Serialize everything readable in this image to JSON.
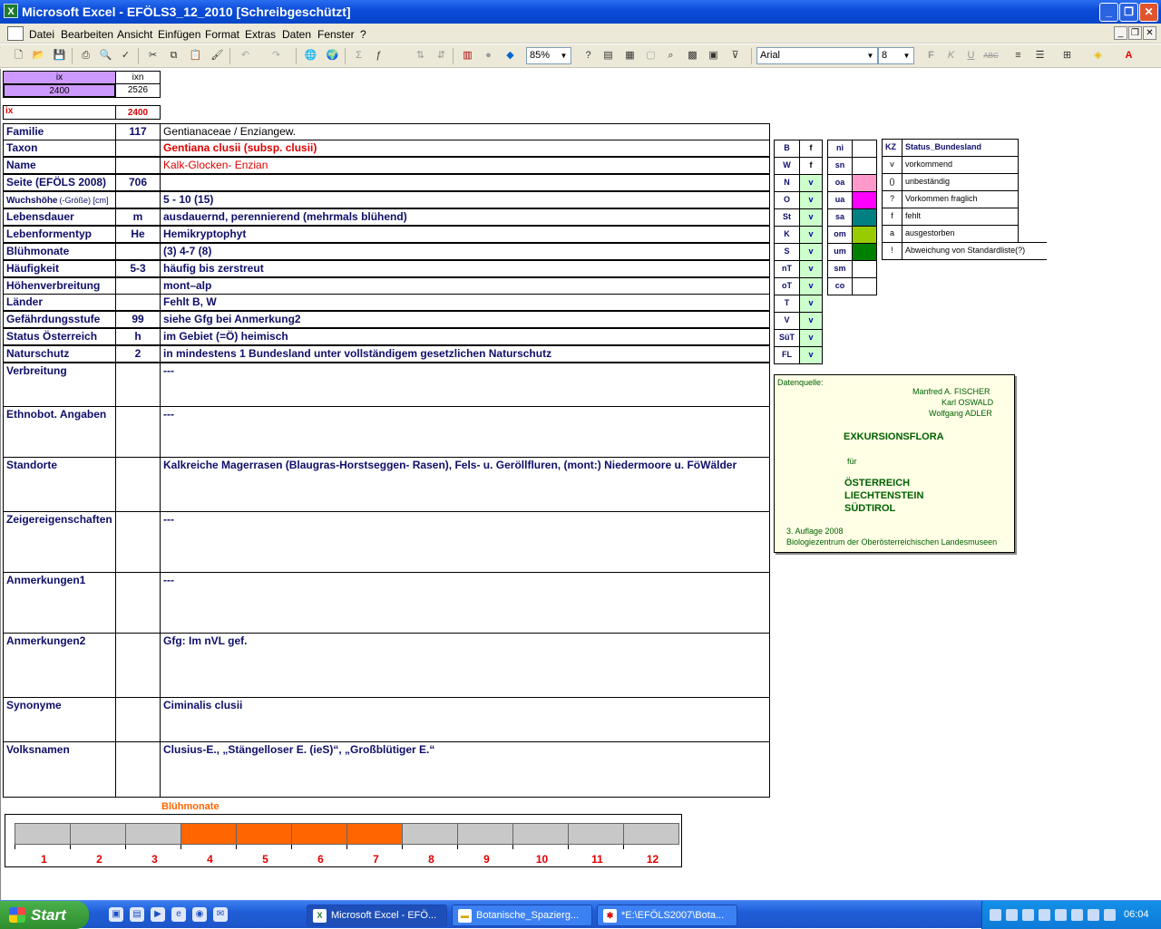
{
  "window": {
    "title": "Microsoft Excel - EFÖLS3_12_2010  [Schreibgeschützt]"
  },
  "menu": [
    "Datei",
    "Bearbeiten",
    "Ansicht",
    "Einfügen",
    "Format",
    "Extras",
    "Daten",
    "Fenster",
    "?"
  ],
  "toolbar": {
    "zoom": "85%",
    "font": "Arial",
    "size": "8",
    "bold": "F",
    "italic": "K",
    "underline": "U",
    "strike": "ABC"
  },
  "top": {
    "ix_head": "ix",
    "ixn_head": "ixn",
    "ix_val": "2400",
    "ixn_val": "2526",
    "ix_label": "ix",
    "ix_red": "2400"
  },
  "rows": [
    {
      "label": "Familie",
      "code": "117",
      "value": "Gentianaceae  /  Enziangew."
    },
    {
      "label": "Taxon",
      "code": "",
      "value": "Gentiana clusii (subsp. clusii)"
    },
    {
      "label": "Name",
      "code": "",
      "value": "Kalk-Glocken- Enzian"
    },
    {
      "label": "Seite (EFÖLS 2008)",
      "code": "706",
      "value": ""
    },
    {
      "label": "Wuchshöhe",
      "label_suffix": "(-Größe) [cm]",
      "code": "",
      "value": " 5 - 10 (15)"
    },
    {
      "label": "Lebensdauer",
      "code": "m",
      "value": "ausdauernd, perennierend (mehrmals blühend)"
    },
    {
      "label": "Lebenformentyp",
      "code": "He",
      "value": "Hemikryptophyt"
    },
    {
      "label": "Blühmonate",
      "code": "",
      "value": "(3) 4-7 (8)"
    },
    {
      "label": "Häufigkeit",
      "code": "5-3",
      "value": "häufig bis zerstreut"
    },
    {
      "label": "Höhenverbreitung",
      "code": "",
      "value": "mont–alp"
    },
    {
      "label": "Länder",
      "code": "",
      "value": "Fehlt B, W"
    },
    {
      "label": "Gefährdungsstufe",
      "code": "99",
      "value": "siehe Gfg bei Anmerkung2"
    },
    {
      "label": "Status Österreich",
      "code": "h",
      "value": "im Gebiet (=Ö) heimisch"
    },
    {
      "label": "Naturschutz",
      "code": "2",
      "value": "in mindestens 1 Bundesland unter vollständigem gesetzlichen Naturschutz"
    },
    {
      "label": "Verbreitung",
      "code": "",
      "value": "---"
    },
    {
      "label": "Ethnobot. Angaben",
      "code": "",
      "value": "---"
    },
    {
      "label": "Standorte",
      "code": "",
      "value": "Kalkreiche Magerrasen (Blaugras-Horstseggen- Rasen), Fels- u. Geröllfluren, (mont:) Niedermoore u. FöWälder"
    },
    {
      "label": "Zeigereigenschaften",
      "code": "",
      "value": "---"
    },
    {
      "label": "Anmerkungen1",
      "code": "",
      "value": "---"
    },
    {
      "label": "Anmerkungen2",
      "code": "",
      "value": "Gfg: Im nVL gef."
    },
    {
      "label": "Synonyme",
      "code": "",
      "value": "Ciminalis clusii"
    },
    {
      "label": "Volksnamen",
      "code": "",
      "value": "Clusius-E., „Stängelloser E. (ieS)“,   „Großblütiger E.“"
    }
  ],
  "laender": [
    {
      "k": "B",
      "v": "f"
    },
    {
      "k": "W",
      "v": "f"
    },
    {
      "k": "N",
      "v": "v"
    },
    {
      "k": "O",
      "v": "v"
    },
    {
      "k": "St",
      "v": "v"
    },
    {
      "k": "K",
      "v": "v"
    },
    {
      "k": "S",
      "v": "v"
    },
    {
      "k": "nT",
      "v": "v"
    },
    {
      "k": "oT",
      "v": "v"
    },
    {
      "k": "T",
      "v": "v"
    },
    {
      "k": "V",
      "v": "v"
    },
    {
      "k": "SüT",
      "v": "v"
    },
    {
      "k": "FL",
      "v": "v"
    }
  ],
  "regions": [
    {
      "k": "ni",
      "color": ""
    },
    {
      "k": "sn",
      "color": ""
    },
    {
      "k": "oa",
      "color": "#ff99cc"
    },
    {
      "k": "ua",
      "color": "#ff00ff"
    },
    {
      "k": "sa",
      "color": "#008080"
    },
    {
      "k": "om",
      "color": "#99cc00"
    },
    {
      "k": "um",
      "color": "#008000"
    },
    {
      "k": "sm",
      "color": ""
    },
    {
      "k": "co",
      "color": ""
    }
  ],
  "status": {
    "head_kz": "KZ",
    "head_label": "Status_Bundesland",
    "items": [
      {
        "k": "v",
        "label": "vorkommend"
      },
      {
        "k": "()",
        "label": "unbeständig"
      },
      {
        "k": "?",
        "label": "Vorkommen fraglich"
      },
      {
        "k": "f",
        "label": "fehlt"
      },
      {
        "k": "a",
        "label": "ausgestorben"
      },
      {
        "k": "!",
        "label": "Abweichung von Standardliste(?)"
      }
    ]
  },
  "datasource": {
    "label": "Datenquelle:",
    "authors": [
      "Manfred A. FISCHER",
      "Karl OSWALD",
      "Wolfgang ADLER"
    ],
    "title": "EXKURSIONSFLORA",
    "fuer": "für",
    "countries": [
      "ÖSTERREICH",
      "LIECHTENSTEIN",
      "SÜDTIROL"
    ],
    "edition": "3. Auflage 2008",
    "publisher": "Biologiezentrum der Oberösterreichischen Landesmuseen"
  },
  "bluehmonate": {
    "title": "Blühmonate",
    "months": [
      "1",
      "2",
      "3",
      "4",
      "5",
      "6",
      "7",
      "8",
      "9",
      "10",
      "11",
      "12"
    ],
    "active": [
      4,
      5,
      6,
      7
    ],
    "active_color": "#ff6600",
    "inactive_color": "#c8c8c8"
  },
  "taskbar": {
    "start": "Start",
    "tasks": [
      "Microsoft Excel - EFÖ...",
      "Botanische_Spazierg...",
      "*E:\\EFÖLS2007\\Bota..."
    ],
    "clock": "06:04"
  }
}
